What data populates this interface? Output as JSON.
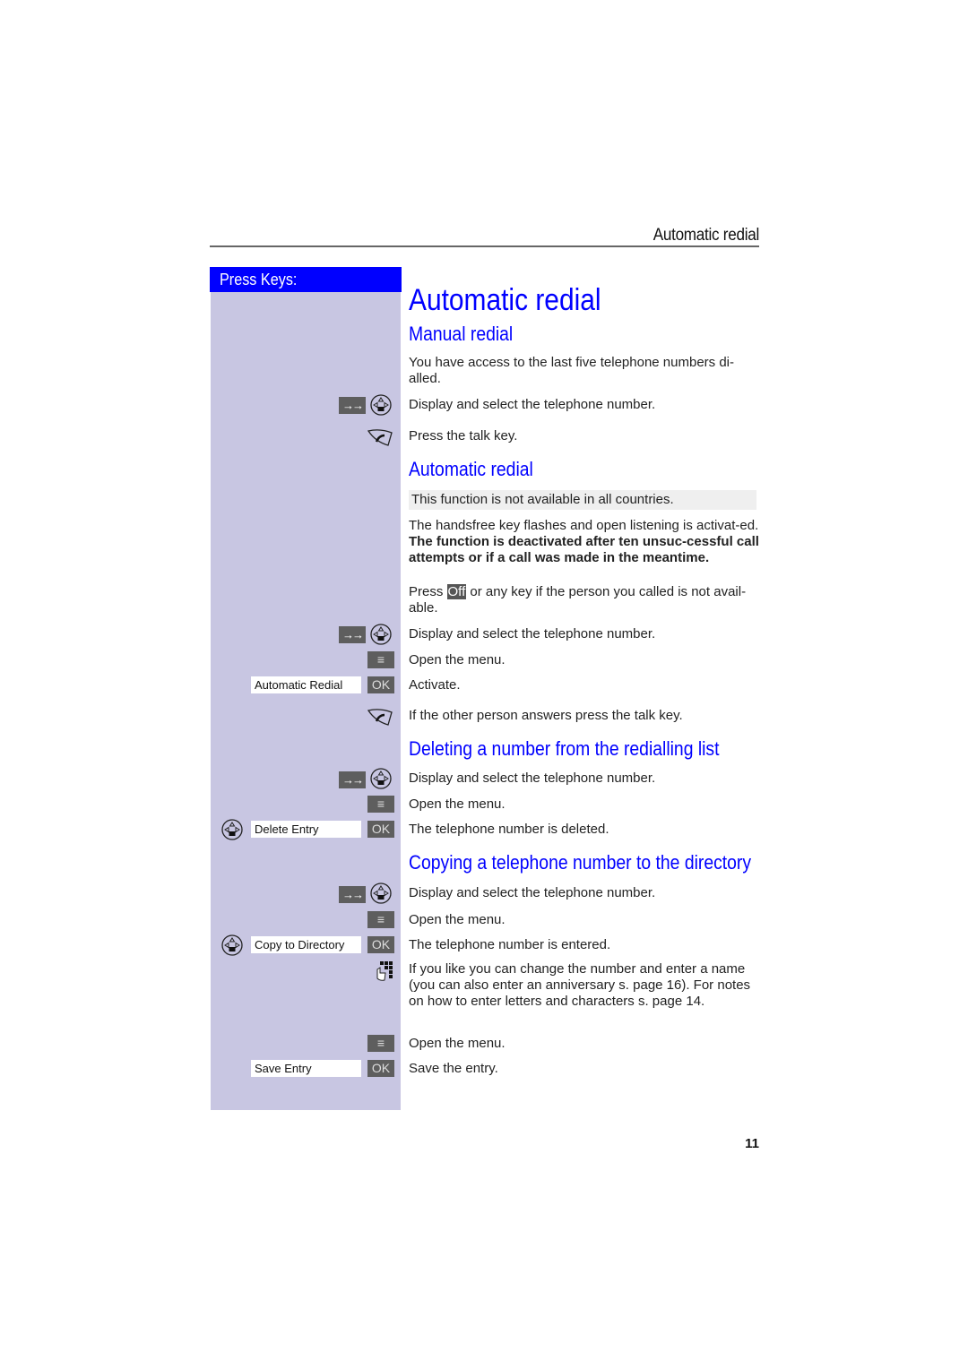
{
  "running_head": "Automatic redial",
  "press_keys_label": "Press Keys:",
  "title": "Automatic redial",
  "sections": {
    "manual": {
      "heading": "Manual redial",
      "intro": "You have access to the last five telephone numbers di-alled.",
      "steps": [
        "Display and select the telephone number.",
        "Press the talk key."
      ]
    },
    "automatic": {
      "heading": "Automatic redial",
      "note": "This function is not available in all countries.",
      "para_plain": "The handsfree key flashes and open listening is activat-ed. ",
      "para_bold": "The function is deactivated after ten unsuc-cessful call attempts or if a call was made in the meantime.",
      "press_prefix": "Press ",
      "off_key": "Off",
      "press_suffix": " or any key if the person you called is not avail-able.",
      "steps": [
        "Display and select the telephone number.",
        "Open the menu.",
        "Activate.",
        "If the other person answers press the talk key."
      ],
      "display_label": "Automatic Redial"
    },
    "delete": {
      "heading": "Deleting a number from the redialling list",
      "steps": [
        "Display and select the telephone number.",
        "Open the menu.",
        "The telephone number is deleted."
      ],
      "display_label": "Delete Entry"
    },
    "copy": {
      "heading": "Copying a telephone number to the directory",
      "steps": [
        "Display and select the telephone number.",
        "Open the menu.",
        "The telephone number is entered.",
        "If you like you can change the number and enter a name (you can also enter an anniversary s. page 16). For notes on how to enter letters and characters s. page 14.",
        "Open the menu.",
        "Save the entry."
      ],
      "display_label": "Copy to Directory",
      "save_label": "Save Entry"
    }
  },
  "keys": {
    "ok": "OK",
    "arrows": "→→"
  },
  "page_number": "11"
}
